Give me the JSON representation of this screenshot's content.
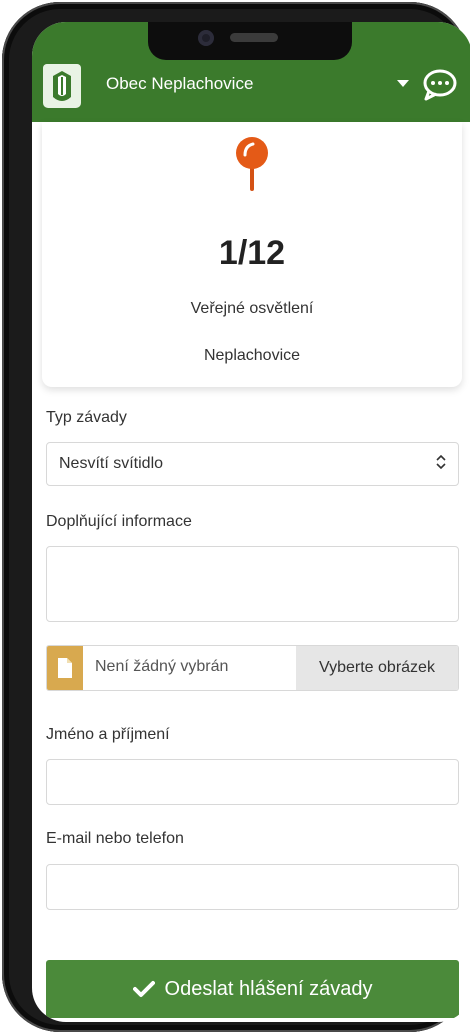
{
  "header": {
    "title": "Obec Neplachovice",
    "brand_color": "#3b7a2c",
    "logo_icon": "coat-of-arms-logo",
    "menu_icon": "chevron-down-icon",
    "chat_icon": "chat-bubble-icon"
  },
  "card": {
    "icon": "map-pin-icon",
    "counter": "1/12",
    "category": "Veřejné osvětlení",
    "location": "Neplachovice"
  },
  "form": {
    "defect_type": {
      "label": "Typ závady",
      "value": "Nesvítí svítidlo"
    },
    "additional_info": {
      "label": "Doplňující informace",
      "value": ""
    },
    "image": {
      "status": "Není žádný vybrán",
      "button": "Vyberte obrázek"
    },
    "name": {
      "label": "Jméno a příjmení",
      "value": ""
    },
    "contact": {
      "label": "E-mail nebo telefon",
      "value": ""
    },
    "submit": {
      "label": "Odeslat hlášení závady",
      "color": "#4b8a3a"
    }
  }
}
